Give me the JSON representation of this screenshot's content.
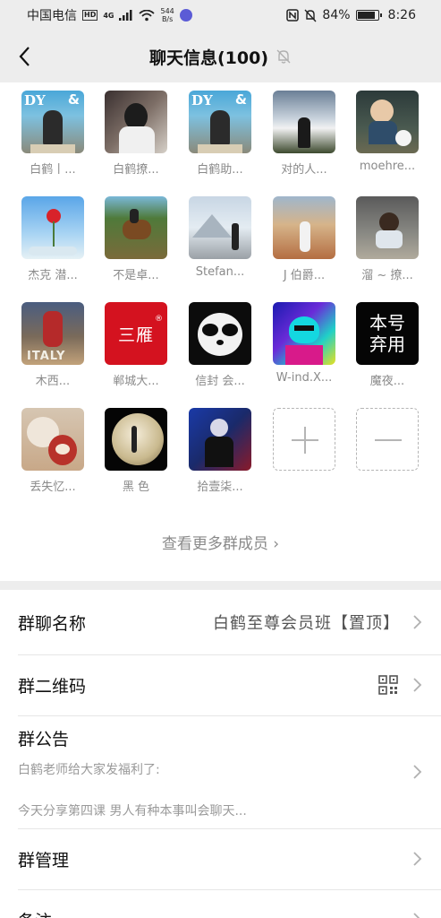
{
  "status_bar": {
    "carrier": "中国电信",
    "hd": "HD",
    "network": "4G",
    "speed_value": "544",
    "speed_unit": "B/s",
    "battery": "84%",
    "time": "8:26"
  },
  "header": {
    "title": "聊天信息(100)",
    "back_icon": "chevron-left-icon",
    "mute_icon": "bell-off-icon"
  },
  "members": [
    {
      "name": "白鹤丨..."
    },
    {
      "name": "白鹤撩..."
    },
    {
      "name": "白鹤助..."
    },
    {
      "name": "对的人..."
    },
    {
      "name": "moehre..."
    },
    {
      "name": "杰克 潜..."
    },
    {
      "name": "不是卓..."
    },
    {
      "name": "Stefan..."
    },
    {
      "name": "J  伯爵..."
    },
    {
      "name": "溜 ~ 撩..."
    },
    {
      "name": "木西..."
    },
    {
      "name": "郸城大..."
    },
    {
      "name": "信封 会..."
    },
    {
      "name": "W-ind.X..."
    },
    {
      "name": "魔夜..."
    },
    {
      "name": "丢失忆..."
    },
    {
      "name": "黑  色"
    },
    {
      "name": "拾壹柒..."
    }
  ],
  "avatar_text": {
    "sanyan": "三雁",
    "reg": "®",
    "benhao_line1": "本号",
    "benhao_line2": "弃用",
    "dy": "DY",
    "amp": "&",
    "italy": "ITALY"
  },
  "add_member_icon": "plus-icon",
  "remove_member_icon": "minus-icon",
  "view_more": "查看更多群成员 ›",
  "settings": {
    "group_name_label": "群聊名称",
    "group_name_value": "白鹤至尊会员班【置顶】",
    "qr_label": "群二维码",
    "notice_label": "群公告",
    "notice_line1": "白鹤老师给大家发福利了:",
    "notice_line2": "今天分享第四课  男人有种本事叫会聊天...",
    "manage_label": "群管理",
    "remark_label": "备注"
  },
  "colors": {
    "background": "#ededed",
    "card": "#ffffff",
    "secondary_text": "#8a8a8a"
  }
}
